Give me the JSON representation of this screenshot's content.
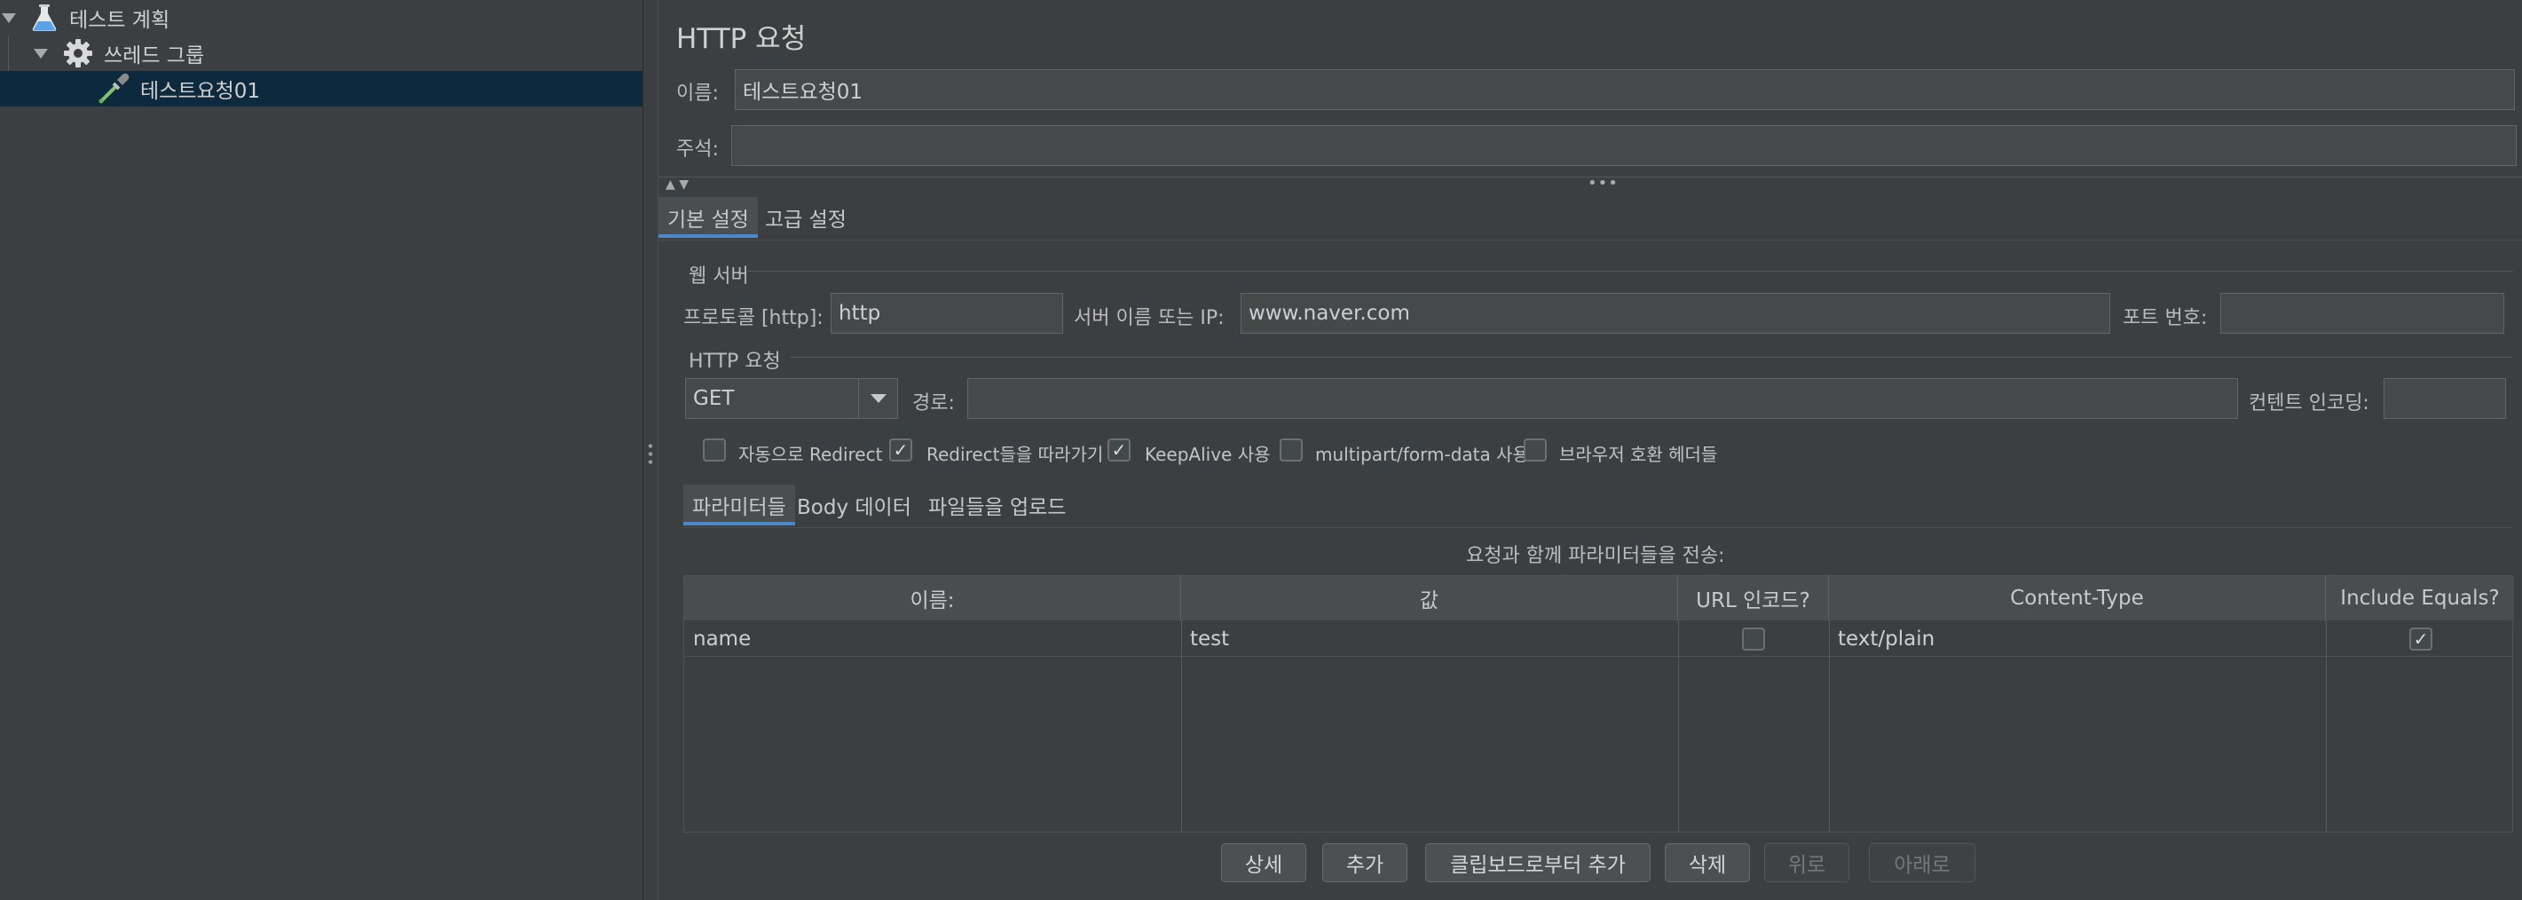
{
  "tree": {
    "items": [
      {
        "label": "테스트 계획",
        "icon": "flask-icon"
      },
      {
        "label": "쓰레드 그룹",
        "icon": "gear-icon"
      },
      {
        "label": "테스트요청01",
        "icon": "pipette-icon"
      }
    ]
  },
  "panel": {
    "title": "HTTP 요청",
    "name_label": "이름:",
    "name_value": "테스트요청01",
    "comment_label": "주석:",
    "comment_value": ""
  },
  "tabs": {
    "basic": "기본 설정",
    "advanced": "고급 설정"
  },
  "web_server": {
    "section_title": "웹 서버",
    "protocol_label": "프로토콜 [http]:",
    "protocol_value": "http",
    "server_label": "서버 이름 또는 IP:",
    "server_value": "www.naver.com",
    "port_label": "포트 번호:",
    "port_value": ""
  },
  "http_request": {
    "section_title": "HTTP 요청",
    "method_value": "GET",
    "path_label": "경로:",
    "path_value": "",
    "encoding_label": "컨텐트 인코딩:",
    "encoding_value": ""
  },
  "checkboxes": [
    {
      "label": "자동으로 Redirect",
      "checked": false
    },
    {
      "label": "Redirect들을 따라가기",
      "checked": true
    },
    {
      "label": "KeepAlive 사용",
      "checked": true
    },
    {
      "label": "multipart/form-data 사용",
      "checked": false
    },
    {
      "label": "브라우저 호환 헤더들",
      "checked": false
    }
  ],
  "subtabs": {
    "params": "파라미터들",
    "body": "Body 데이터",
    "files": "파일들을 업로드"
  },
  "params": {
    "caption": "요청과 함께 파라미터들을 전송:",
    "headers": [
      "이름:",
      "값",
      "URL 인코드?",
      "Content-Type",
      "Include Equals?"
    ],
    "rows": [
      {
        "name": "name",
        "value": "test",
        "url_encode": false,
        "content_type": "text/plain",
        "include_equals": true
      }
    ]
  },
  "buttons": {
    "detail": "상세",
    "add": "추가",
    "add_clipboard": "클립보드로부터 추가",
    "delete": "삭제",
    "up": "위로",
    "down": "아래로"
  },
  "colors": {
    "accent": "#4a88c7",
    "background": "#3c3f41",
    "selection": "#0d293e"
  }
}
